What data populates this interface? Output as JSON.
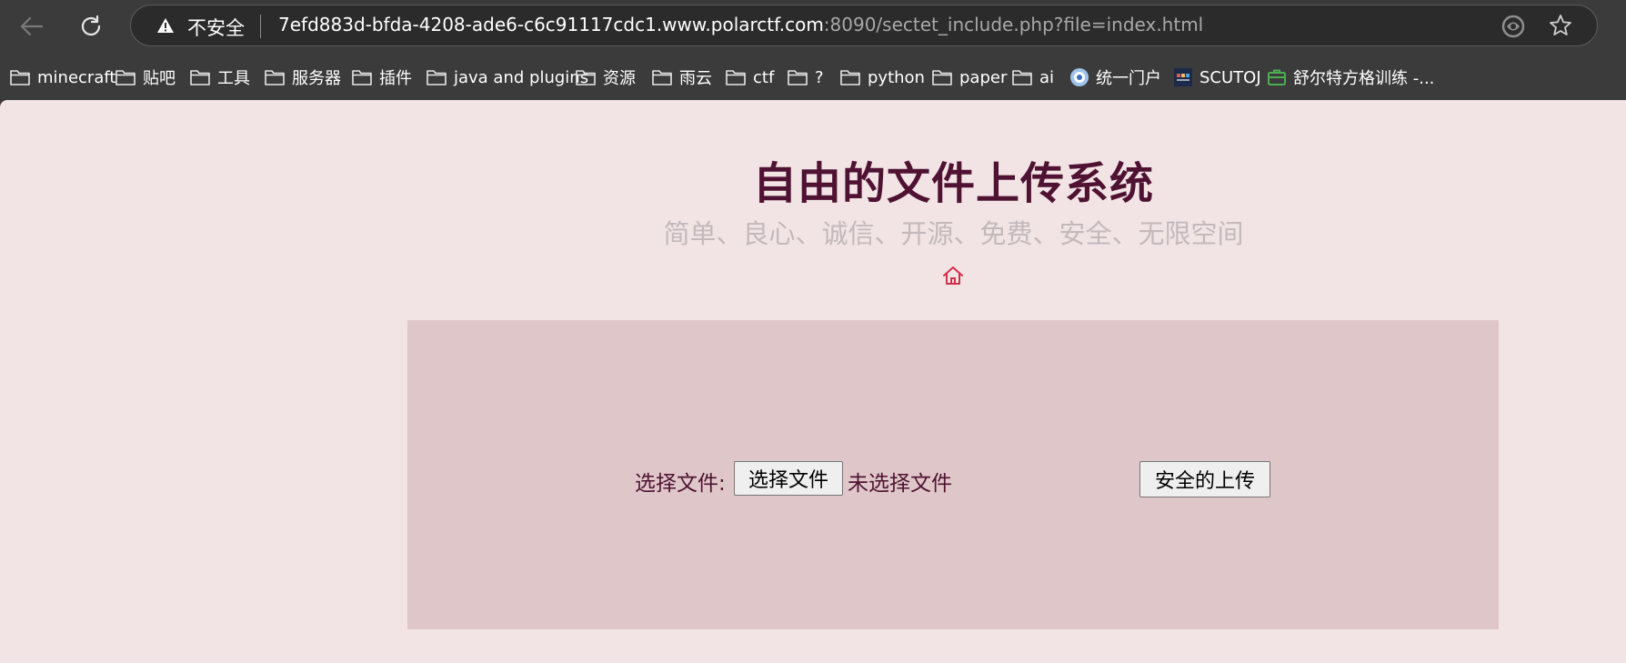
{
  "browser": {
    "url_warning": "不安全",
    "url_host": "7efd883d-bfda-4208-ade6-c6c91117cdc1.www.polarctf.com",
    "url_rest": ":8090/sectet_include.php?file=index.html"
  },
  "bookmarks": [
    {
      "label": "minecraft",
      "icon": "folder-icon"
    },
    {
      "label": "贴吧",
      "icon": "folder-icon"
    },
    {
      "label": "工具",
      "icon": "folder-icon"
    },
    {
      "label": "服务器",
      "icon": "folder-icon"
    },
    {
      "label": "插件",
      "icon": "folder-icon"
    },
    {
      "label": "java and plugins",
      "icon": "folder-icon"
    },
    {
      "label": "资源",
      "icon": "folder-icon"
    },
    {
      "label": "雨云",
      "icon": "folder-icon"
    },
    {
      "label": "ctf",
      "icon": "folder-icon"
    },
    {
      "label": "?",
      "icon": "folder-icon"
    },
    {
      "label": "python",
      "icon": "folder-icon"
    },
    {
      "label": "paper",
      "icon": "folder-icon"
    },
    {
      "label": "ai",
      "icon": "folder-icon"
    },
    {
      "label": "统一门户",
      "icon": "globe-icon"
    },
    {
      "label": "SCUTOJ",
      "icon": "site-icon"
    },
    {
      "label": "舒尔特方格训练 -...",
      "icon": "briefcase-icon"
    }
  ],
  "page": {
    "title": "自由的文件上传系统",
    "subtitle": "简单、良心、诚信、开源、免费、安全、无限空间",
    "home_icon": "home-icon"
  },
  "upload": {
    "label": "选择文件:",
    "file_button": "选择文件",
    "no_file_text": "未选择文件",
    "submit_button": "安全的上传"
  },
  "colors": {
    "background": "#f2e4e5",
    "panel": "#dfc7c9",
    "title": "#4f1232",
    "subtitle": "#c3b9bc",
    "home_icon": "#d2304a"
  }
}
